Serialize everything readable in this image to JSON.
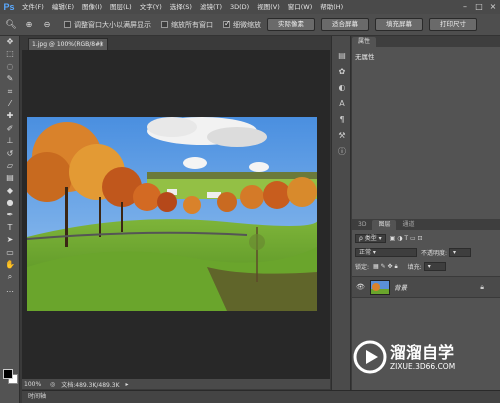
{
  "menubar": {
    "logo": "Ps",
    "items": [
      "文件(F)",
      "编辑(E)",
      "图像(I)",
      "图层(L)",
      "文字(Y)",
      "选择(S)",
      "滤镜(T)",
      "3D(D)",
      "视图(V)",
      "窗口(W)",
      "帮助(H)"
    ],
    "window_controls": [
      "–",
      "□",
      "×"
    ]
  },
  "options": {
    "checkboxes": [
      {
        "label": "调整窗口大小以满屏显示",
        "checked": false
      },
      {
        "label": "缩放所有窗口",
        "checked": false
      },
      {
        "label": "细微缩放",
        "checked": true
      }
    ],
    "buttons": [
      "实际像素",
      "适合屏幕",
      "填充屏幕",
      "打印尺寸"
    ]
  },
  "document": {
    "tab_title": "1.jpg @ 100%(RGB/8#)",
    "close": "×"
  },
  "status": {
    "zoom": "100%",
    "doc_info": "文档:489.3K/489.3K"
  },
  "timeline_label": "时间轴",
  "properties": {
    "tab": "属性",
    "empty_text": "无属性"
  },
  "layers": {
    "tabs": [
      "3D",
      "图层",
      "通道"
    ],
    "filter_label": "类型",
    "blend_mode": "正常",
    "opacity_label": "不透明度:",
    "lock_label": "锁定:",
    "fill_label": "填充:",
    "items": [
      {
        "name": "背景"
      }
    ]
  },
  "watermark": {
    "title": "溜溜自学",
    "url": "ZIXUE.3D66.COM"
  }
}
